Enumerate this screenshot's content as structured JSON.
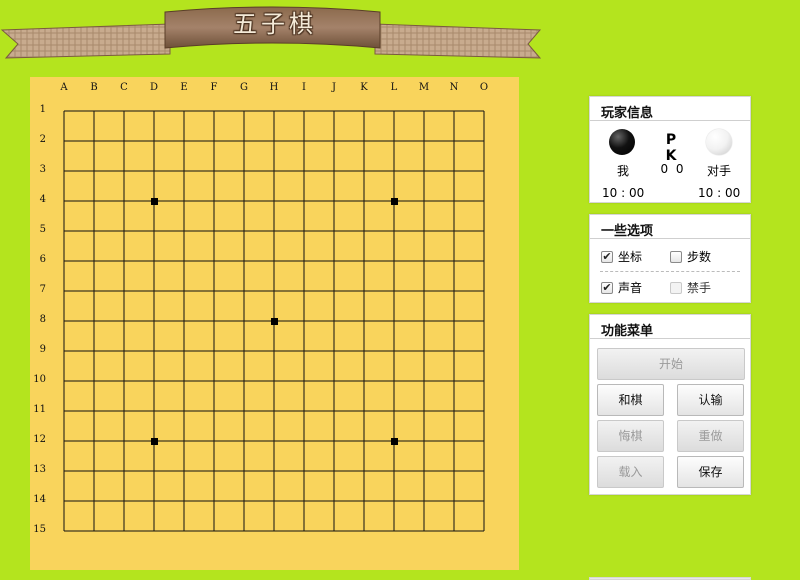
{
  "app": {
    "title": "五子棋"
  },
  "board": {
    "size": 15,
    "col_labels": [
      "A",
      "B",
      "C",
      "D",
      "E",
      "F",
      "G",
      "H",
      "I",
      "J",
      "K",
      "L",
      "M",
      "N",
      "O"
    ],
    "row_labels": [
      "1",
      "2",
      "3",
      "4",
      "5",
      "6",
      "7",
      "8",
      "9",
      "10",
      "11",
      "12",
      "13",
      "14",
      "15"
    ],
    "star_points": [
      [
        "D",
        4
      ],
      [
        "L",
        4
      ],
      [
        "H",
        8
      ],
      [
        "D",
        12
      ],
      [
        "L",
        12
      ]
    ],
    "stones": [],
    "colors": {
      "board": "#f9d45c",
      "line": "#111111",
      "background": "#b4e41e"
    }
  },
  "player_panel": {
    "title": "玩家信息",
    "vs_label": "P K",
    "me": {
      "label": "我",
      "stone": "black",
      "score": "0",
      "time": "10 : 00"
    },
    "opponent": {
      "label": "对手",
      "stone": "white",
      "score": "0",
      "time": "10 : 00"
    },
    "score_text": "0  0"
  },
  "options_panel": {
    "title": "一些选项",
    "options": [
      {
        "label": "坐标",
        "checked": true,
        "enabled": true
      },
      {
        "label": "步数",
        "checked": false,
        "enabled": true
      },
      {
        "label": "声音",
        "checked": true,
        "enabled": true
      },
      {
        "label": "禁手",
        "checked": false,
        "enabled": false
      }
    ]
  },
  "menu_panel": {
    "title": "功能菜单",
    "buttons": {
      "start": {
        "label": "开始",
        "enabled": false
      },
      "draw": {
        "label": "和棋",
        "enabled": true
      },
      "resign": {
        "label": "认输",
        "enabled": true
      },
      "undo": {
        "label": "悔棋",
        "enabled": false
      },
      "redo": {
        "label": "重做",
        "enabled": false
      },
      "load": {
        "label": "载入",
        "enabled": false
      },
      "save": {
        "label": "保存",
        "enabled": true
      }
    }
  }
}
